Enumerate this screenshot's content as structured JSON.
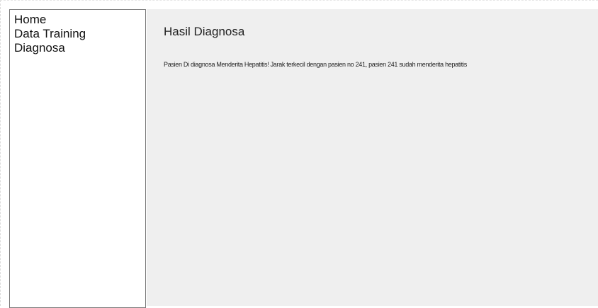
{
  "sidebar": {
    "items": [
      {
        "label": "Home"
      },
      {
        "label": "Data Training"
      },
      {
        "label": "Diagnosa"
      }
    ]
  },
  "main": {
    "title": "Hasil Diagnosa",
    "result": "Pasien Di diagnosa Menderita Hepatitis! Jarak terkecil dengan pasien no 241, pasien 241 sudah menderita hepatitis"
  }
}
